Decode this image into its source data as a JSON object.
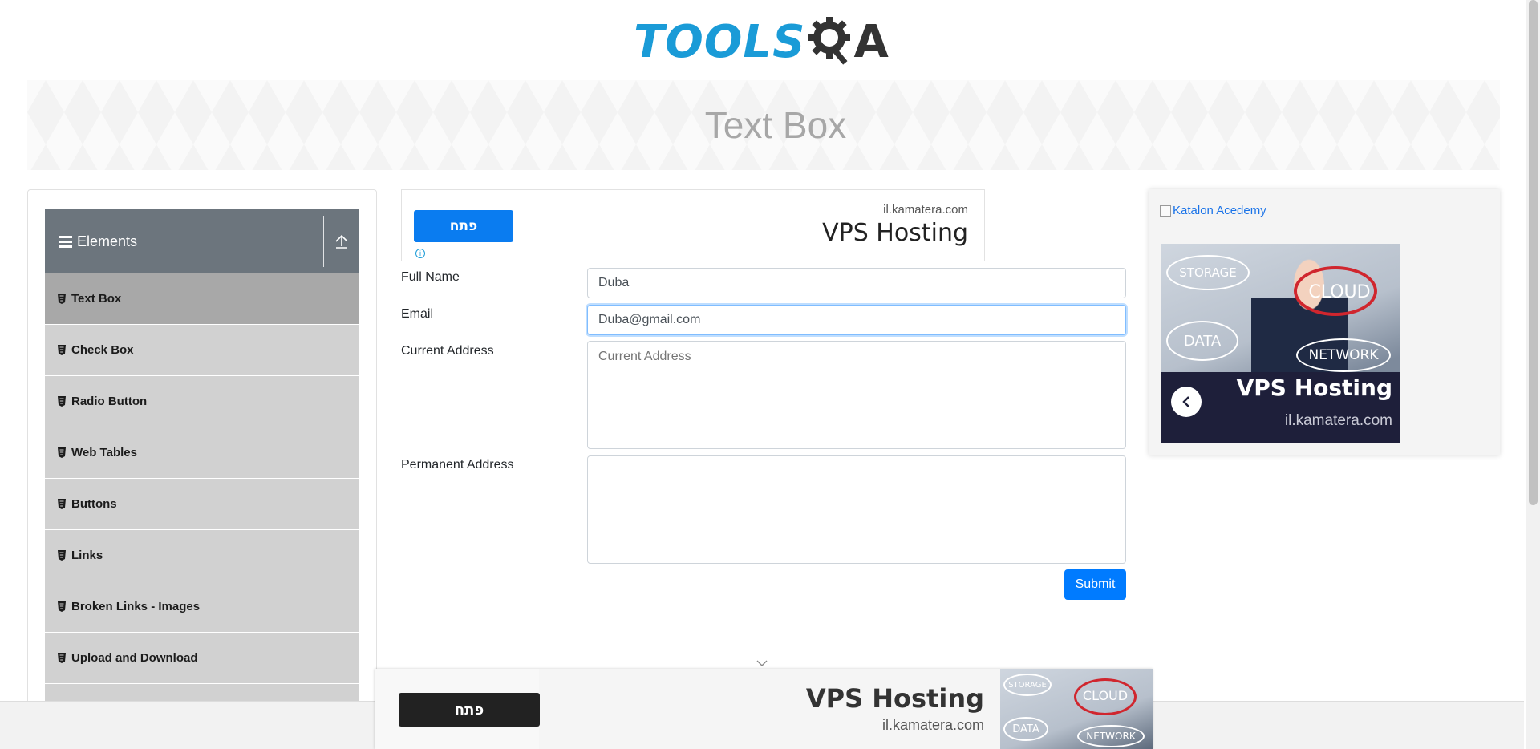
{
  "header": {
    "logo_text": "TOOLS",
    "logo_suffix": "A"
  },
  "banner": {
    "title": "Text Box"
  },
  "sidebar": {
    "group_title": "Elements",
    "items": [
      {
        "label": "Text Box",
        "active": true
      },
      {
        "label": "Check Box"
      },
      {
        "label": "Radio Button"
      },
      {
        "label": "Web Tables"
      },
      {
        "label": "Buttons"
      },
      {
        "label": "Links"
      },
      {
        "label": "Broken Links - Images"
      },
      {
        "label": "Upload and Download"
      }
    ]
  },
  "top_ad": {
    "button_label": "פתח",
    "domain": "il.kamatera.com",
    "title": "VPS Hosting",
    "info_glyph": "i"
  },
  "form": {
    "full_name_label": "Full Name",
    "full_name_value": "Duba",
    "email_label": "Email",
    "email_value": "Duba@gmail.com",
    "current_address_label": "Current Address",
    "current_address_placeholder": "Current Address",
    "permanent_address_label": "Permanent Address",
    "submit_label": "Submit"
  },
  "right_ad": {
    "image_alt": "Katalon Acedemy",
    "bubbles": [
      "STORAGE",
      "CLOUD",
      "DATA",
      "NETWORK"
    ],
    "title": "VPS Hosting",
    "domain": "il.kamatera.com"
  },
  "bottom_ad": {
    "button_label": "פתח",
    "title": "VPS Hosting",
    "domain": "il.kamatera.com",
    "bubbles": [
      "STORAGE",
      "CLOUD",
      "DATA",
      "NETWORK"
    ]
  },
  "colors": {
    "brand_blue": "#1a9bd7",
    "primary": "#007bff",
    "sidebar_header": "#6c757d",
    "menu_item": "#d1d1d1",
    "menu_item_active": "#a8a8a8"
  }
}
